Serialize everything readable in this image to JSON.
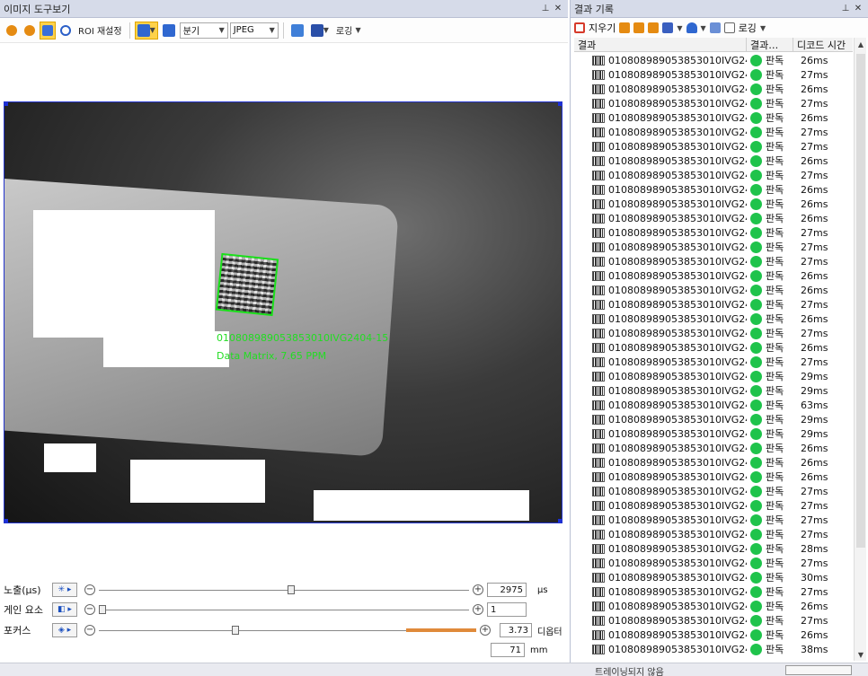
{
  "left_panel": {
    "title": "이미지 도구보기",
    "toolbar": {
      "roi_reset_label": "ROI 재설정",
      "split_select": "분기",
      "format_select": "JPEG",
      "logging_label": "로깅"
    },
    "overlay": {
      "decoded_text": "010808989053853010IVG2404-15",
      "symbology_text": "Data Matrix, 7.65 PPM"
    },
    "controls": {
      "exposure": {
        "label": "노출(µs)",
        "value": "2975",
        "unit": "µs",
        "level": 0.52
      },
      "gain": {
        "label": "게인 요소",
        "value": "1",
        "level": 0.0
      },
      "focus": {
        "label": "포커스",
        "value": "3.73",
        "unit": "디옵터",
        "value2": "71",
        "unit2": "mm",
        "level": 0.36
      }
    }
  },
  "right_panel": {
    "title": "결과 기록",
    "toolbar": {
      "clear_label": "지우기",
      "logging_label": "로깅"
    },
    "columns": [
      "결과",
      "결과…",
      "디코드 시간"
    ],
    "rows": [
      {
        "code": "010808989053853010IVG24…",
        "status": "판독",
        "time": "26ms"
      },
      {
        "code": "010808989053853010IVG24…",
        "status": "판독",
        "time": "27ms"
      },
      {
        "code": "010808989053853010IVG24…",
        "status": "판독",
        "time": "26ms"
      },
      {
        "code": "010808989053853010IVG24…",
        "status": "판독",
        "time": "27ms"
      },
      {
        "code": "010808989053853010IVG24…",
        "status": "판독",
        "time": "26ms"
      },
      {
        "code": "010808989053853010IVG24…",
        "status": "판독",
        "time": "27ms"
      },
      {
        "code": "010808989053853010IVG24…",
        "status": "판독",
        "time": "27ms"
      },
      {
        "code": "010808989053853010IVG24…",
        "status": "판독",
        "time": "26ms"
      },
      {
        "code": "010808989053853010IVG24…",
        "status": "판독",
        "time": "27ms"
      },
      {
        "code": "010808989053853010IVG24…",
        "status": "판독",
        "time": "26ms"
      },
      {
        "code": "010808989053853010IVG24…",
        "status": "판독",
        "time": "26ms"
      },
      {
        "code": "010808989053853010IVG24…",
        "status": "판독",
        "time": "26ms"
      },
      {
        "code": "010808989053853010IVG24…",
        "status": "판독",
        "time": "27ms"
      },
      {
        "code": "010808989053853010IVG24…",
        "status": "판독",
        "time": "27ms"
      },
      {
        "code": "010808989053853010IVG24…",
        "status": "판독",
        "time": "27ms"
      },
      {
        "code": "010808989053853010IVG24…",
        "status": "판독",
        "time": "26ms"
      },
      {
        "code": "010808989053853010IVG24…",
        "status": "판독",
        "time": "26ms"
      },
      {
        "code": "010808989053853010IVG24…",
        "status": "판독",
        "time": "27ms"
      },
      {
        "code": "010808989053853010IVG24…",
        "status": "판독",
        "time": "26ms"
      },
      {
        "code": "010808989053853010IVG24…",
        "status": "판독",
        "time": "27ms"
      },
      {
        "code": "010808989053853010IVG24…",
        "status": "판독",
        "time": "26ms"
      },
      {
        "code": "010808989053853010IVG24…",
        "status": "판독",
        "time": "27ms"
      },
      {
        "code": "010808989053853010IVG24…",
        "status": "판독",
        "time": "29ms"
      },
      {
        "code": "010808989053853010IVG24…",
        "status": "판독",
        "time": "29ms"
      },
      {
        "code": "010808989053853010IVG24…",
        "status": "판독",
        "time": "63ms"
      },
      {
        "code": "010808989053853010IVG24…",
        "status": "판독",
        "time": "29ms"
      },
      {
        "code": "010808989053853010IVG24…",
        "status": "판독",
        "time": "29ms"
      },
      {
        "code": "010808989053853010IVG24…",
        "status": "판독",
        "time": "26ms"
      },
      {
        "code": "010808989053853010IVG24…",
        "status": "판독",
        "time": "26ms"
      },
      {
        "code": "010808989053853010IVG24…",
        "status": "판독",
        "time": "26ms"
      },
      {
        "code": "010808989053853010IVG24…",
        "status": "판독",
        "time": "27ms"
      },
      {
        "code": "010808989053853010IVG24…",
        "status": "판독",
        "time": "27ms"
      },
      {
        "code": "010808989053853010IVG24…",
        "status": "판독",
        "time": "27ms"
      },
      {
        "code": "010808989053853010IVG24…",
        "status": "판독",
        "time": "27ms"
      },
      {
        "code": "010808989053853010IVG24…",
        "status": "판독",
        "time": "28ms"
      },
      {
        "code": "010808989053853010IVG24…",
        "status": "판독",
        "time": "27ms"
      },
      {
        "code": "010808989053853010IVG24…",
        "status": "판독",
        "time": "30ms"
      },
      {
        "code": "010808989053853010IVG24…",
        "status": "판독",
        "time": "27ms"
      },
      {
        "code": "010808989053853010IVG24…",
        "status": "판독",
        "time": "26ms"
      },
      {
        "code": "010808989053853010IVG24…",
        "status": "판독",
        "time": "27ms"
      },
      {
        "code": "010808989053853010IVG24…",
        "status": "판독",
        "time": "26ms"
      },
      {
        "code": "010808989053853010IVG24…",
        "status": "판독",
        "time": "38ms"
      }
    ]
  },
  "status_bar": {
    "text": "트레이닝되지 않음"
  },
  "colors": {
    "read_ok": "#1fc34b",
    "accent_orange": "#e08a3a",
    "roi_blue": "#1c2fd8",
    "overlay_green": "#22dd22"
  }
}
